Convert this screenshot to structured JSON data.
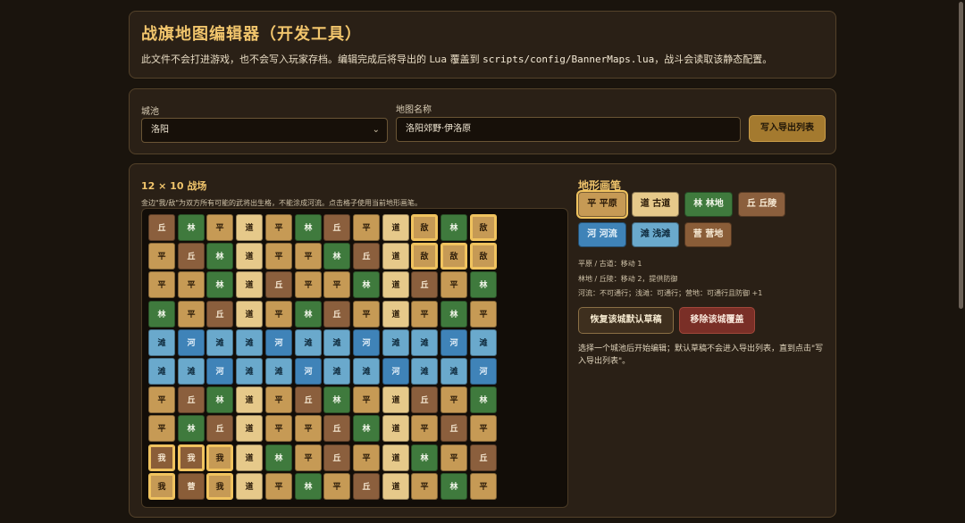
{
  "header": {
    "title": "战旗地图编辑器（开发工具）",
    "desc_before": "此文件不会打进游戏，也不会写入玩家存档。编辑完成后将导出的 Lua 覆盖到 ",
    "desc_path": "scripts/config/BannerMaps.lua",
    "desc_after": "，战斗会读取该静态配置。"
  },
  "controls": {
    "city_label": "城池",
    "city_value": "洛阳",
    "map_name_label": "地图名称",
    "map_name_value": "洛阳郊野·伊洛原",
    "write_button": "写入导出列表"
  },
  "editor": {
    "grid_title": "12 × 10 战场",
    "grid_hint": "金边\"我/敌\"为双方所有可能的武将出生格，不能涂成河流。点击格子使用当前地形画笔。",
    "legend_key": {
      "丘": "hill",
      "林": "forest",
      "平": "plain",
      "道": "road",
      "河": "river",
      "滩": "shoal",
      "营": "camp",
      "我": "camp",
      "敌": "camp"
    },
    "rows": [
      [
        "丘",
        "林",
        "平",
        "道",
        "平",
        "林",
        "丘",
        "平",
        "道",
        "敌",
        "林",
        "敌"
      ],
      [
        "平",
        "丘",
        "林",
        "道",
        "平",
        "平",
        "林",
        "丘",
        "道",
        "敌",
        "敌",
        "敌"
      ],
      [
        "平",
        "平",
        "林",
        "道",
        "丘",
        "平",
        "平",
        "林",
        "道",
        "丘",
        "平",
        "林"
      ],
      [
        "林",
        "平",
        "丘",
        "道",
        "平",
        "林",
        "丘",
        "平",
        "道",
        "平",
        "林",
        "平"
      ],
      [
        "滩",
        "河",
        "滩",
        "滩",
        "河",
        "滩",
        "滩",
        "河",
        "滩",
        "滩",
        "河",
        "滩"
      ],
      [
        "滩",
        "滩",
        "河",
        "滩",
        "滩",
        "河",
        "滩",
        "滩",
        "河",
        "滩",
        "滩",
        "河"
      ],
      [
        "平",
        "丘",
        "林",
        "道",
        "平",
        "丘",
        "林",
        "平",
        "道",
        "丘",
        "平",
        "林"
      ],
      [
        "平",
        "林",
        "丘",
        "道",
        "平",
        "平",
        "丘",
        "林",
        "道",
        "平",
        "丘",
        "平"
      ],
      [
        "我",
        "我",
        "我",
        "道",
        "林",
        "平",
        "丘",
        "平",
        "道",
        "林",
        "平",
        "丘"
      ],
      [
        "我",
        "营",
        "我",
        "道",
        "平",
        "林",
        "平",
        "丘",
        "道",
        "平",
        "林",
        "平"
      ]
    ],
    "row_types": [
      [
        "hill",
        "forest",
        "plain",
        "road",
        "plain",
        "forest",
        "hill",
        "plain",
        "road",
        "plain",
        "forest",
        "plain"
      ],
      [
        "plain",
        "hill",
        "forest",
        "road",
        "plain",
        "plain",
        "forest",
        "hill",
        "road",
        "plain",
        "plain",
        "plain"
      ],
      [
        "plain",
        "plain",
        "forest",
        "road",
        "hill",
        "plain",
        "plain",
        "forest",
        "road",
        "hill",
        "plain",
        "forest"
      ],
      [
        "forest",
        "plain",
        "hill",
        "road",
        "plain",
        "forest",
        "hill",
        "plain",
        "road",
        "plain",
        "forest",
        "plain"
      ],
      [
        "shoal",
        "river",
        "shoal",
        "shoal",
        "river",
        "shoal",
        "shoal",
        "river",
        "shoal",
        "shoal",
        "river",
        "shoal"
      ],
      [
        "shoal",
        "shoal",
        "river",
        "shoal",
        "shoal",
        "river",
        "shoal",
        "shoal",
        "river",
        "shoal",
        "shoal",
        "river"
      ],
      [
        "plain",
        "hill",
        "forest",
        "road",
        "plain",
        "hill",
        "forest",
        "plain",
        "road",
        "hill",
        "plain",
        "forest"
      ],
      [
        "plain",
        "forest",
        "hill",
        "road",
        "plain",
        "plain",
        "hill",
        "forest",
        "road",
        "plain",
        "hill",
        "plain"
      ],
      [
        "camp",
        "camp",
        "plain",
        "road",
        "forest",
        "plain",
        "hill",
        "plain",
        "road",
        "forest",
        "plain",
        "hill"
      ],
      [
        "plain",
        "camp",
        "plain",
        "road",
        "plain",
        "forest",
        "plain",
        "hill",
        "road",
        "plain",
        "forest",
        "plain"
      ]
    ],
    "spawn_cells": [
      [
        0,
        9
      ],
      [
        0,
        11
      ],
      [
        1,
        9
      ],
      [
        1,
        10
      ],
      [
        1,
        11
      ],
      [
        8,
        0
      ],
      [
        8,
        1
      ],
      [
        8,
        2
      ],
      [
        9,
        0
      ],
      [
        9,
        2
      ]
    ],
    "brush_title": "地形画笔",
    "brushes": [
      {
        "label": "平 平原",
        "type": "plain",
        "selected": true
      },
      {
        "label": "道 古道",
        "type": "road",
        "selected": false
      },
      {
        "label": "林 林地",
        "type": "forest",
        "selected": false
      },
      {
        "label": "丘 丘陵",
        "type": "hill",
        "selected": false
      },
      {
        "label": "河 河流",
        "type": "river",
        "selected": false
      },
      {
        "label": "滩 浅滩",
        "type": "shoal",
        "selected": false
      },
      {
        "label": "营 营地",
        "type": "camp",
        "selected": false
      }
    ],
    "legend": [
      "平原 / 古道：移动 1",
      "林地 / 丘陵：移动 2，提供防御",
      "河流：不可通行；浅滩：可通行；营地：可通行且防御 +1"
    ],
    "restore_button": "恢复该城默认草稿",
    "remove_button": "移除该城覆盖",
    "note": "选择一个城池后开始编辑；默认草稿不会进入导出列表，直到点击\"写入导出列表\"。"
  },
  "colors": {
    "accent_gold": "#f1c56c",
    "panel": "#2a2016",
    "background": "#1a140d",
    "danger": "#7a2f27"
  }
}
